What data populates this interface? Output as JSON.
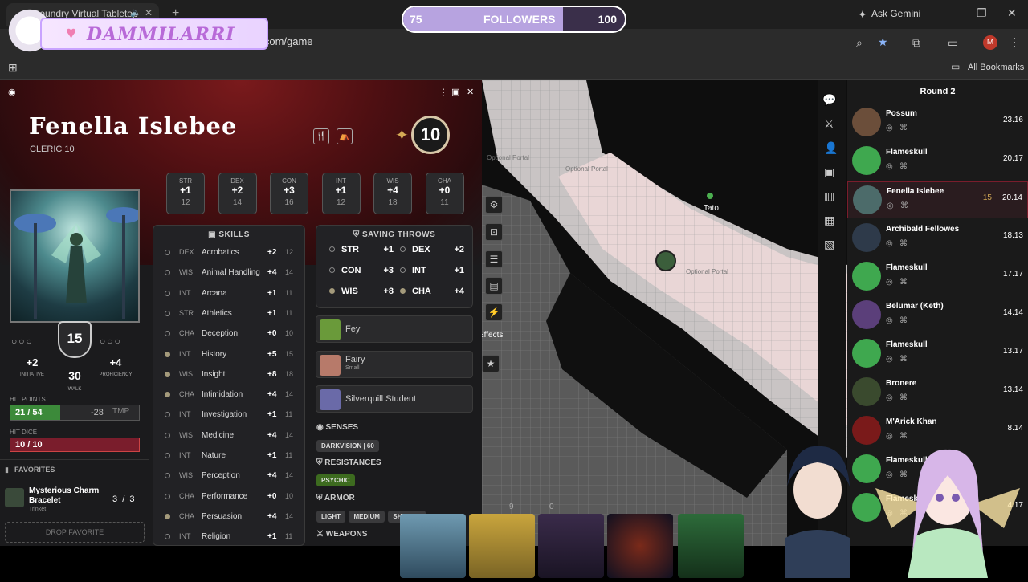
{
  "browser": {
    "tab_title": "Foundry Virtual Tabletop",
    "url": "g.com/game",
    "ask_gemini": "Ask Gemini",
    "profile_initial": "M",
    "all_bookmarks": "All Bookmarks"
  },
  "overlay": {
    "streamer_name": "DAMMILARRI",
    "followers": {
      "start": "75",
      "label": "FOLLOWERS",
      "end": "100",
      "progress": 0.72
    }
  },
  "character": {
    "name": "Fenella Islebee",
    "class_level": "CLERIC 10",
    "level": "10",
    "abilities": [
      {
        "name": "STR",
        "mod": "+1",
        "score": "12"
      },
      {
        "name": "DEX",
        "mod": "+2",
        "score": "14"
      },
      {
        "name": "CON",
        "mod": "+3",
        "score": "16"
      },
      {
        "name": "INT",
        "mod": "+1",
        "score": "12"
      },
      {
        "name": "WIS",
        "mod": "+4",
        "score": "18"
      },
      {
        "name": "CHA",
        "mod": "+0",
        "score": "11"
      }
    ],
    "ac": "15",
    "initiative": "+2",
    "initiative_label": "INITIATIVE",
    "proficiency": "+4",
    "proficiency_label": "PROFICIENCY",
    "walk": "30",
    "walk_label": "WALK",
    "hp_label": "HIT POINTS",
    "hp": "21",
    "hp_max": "54",
    "hp_fraction": 0.39,
    "hp_loss": "-28",
    "tmp_label": "TMP",
    "hd_label": "HIT DICE",
    "hit_dice": "10 / 10",
    "favorites_label": "FAVORITES",
    "favorite": {
      "name": "Mysterious Charm Bracelet",
      "type": "Trinket",
      "uses": "3",
      "max": "3"
    },
    "drop_favorite": "DROP FAVORITE"
  },
  "skills": {
    "title": "SKILLS",
    "rows": [
      {
        "ab": "DEX",
        "name": "Acrobatics",
        "mod": "+2",
        "pass": "12",
        "prof": false
      },
      {
        "ab": "WIS",
        "name": "Animal Handling",
        "mod": "+4",
        "pass": "14",
        "prof": false
      },
      {
        "ab": "INT",
        "name": "Arcana",
        "mod": "+1",
        "pass": "11",
        "prof": false
      },
      {
        "ab": "STR",
        "name": "Athletics",
        "mod": "+1",
        "pass": "11",
        "prof": false
      },
      {
        "ab": "CHA",
        "name": "Deception",
        "mod": "+0",
        "pass": "10",
        "prof": false
      },
      {
        "ab": "INT",
        "name": "History",
        "mod": "+5",
        "pass": "15",
        "prof": true
      },
      {
        "ab": "WIS",
        "name": "Insight",
        "mod": "+8",
        "pass": "18",
        "prof": true
      },
      {
        "ab": "CHA",
        "name": "Intimidation",
        "mod": "+4",
        "pass": "14",
        "prof": true
      },
      {
        "ab": "INT",
        "name": "Investigation",
        "mod": "+1",
        "pass": "11",
        "prof": false
      },
      {
        "ab": "WIS",
        "name": "Medicine",
        "mod": "+4",
        "pass": "14",
        "prof": false
      },
      {
        "ab": "INT",
        "name": "Nature",
        "mod": "+1",
        "pass": "11",
        "prof": false
      },
      {
        "ab": "WIS",
        "name": "Perception",
        "mod": "+4",
        "pass": "14",
        "prof": false
      },
      {
        "ab": "CHA",
        "name": "Performance",
        "mod": "+0",
        "pass": "10",
        "prof": false
      },
      {
        "ab": "CHA",
        "name": "Persuasion",
        "mod": "+4",
        "pass": "14",
        "prof": true
      },
      {
        "ab": "INT",
        "name": "Religion",
        "mod": "+1",
        "pass": "11",
        "prof": false
      }
    ]
  },
  "saves": {
    "title": "SAVING THROWS",
    "rows": [
      {
        "name": "STR",
        "mod": "+1",
        "prof": false
      },
      {
        "name": "DEX",
        "mod": "+2",
        "prof": false
      },
      {
        "name": "CON",
        "mod": "+3",
        "prof": false
      },
      {
        "name": "INT",
        "mod": "+1",
        "prof": false
      },
      {
        "name": "WIS",
        "mod": "+8",
        "prof": true
      },
      {
        "name": "CHA",
        "mod": "+4",
        "prof": true
      }
    ]
  },
  "features": [
    {
      "name": "Fey",
      "sub": ""
    },
    {
      "name": "Fairy",
      "sub": "Small"
    },
    {
      "name": "Silverquill Student",
      "sub": ""
    }
  ],
  "traits": {
    "senses_label": "SENSES",
    "darkvision": "DARKVISION",
    "darkvision_value": "60",
    "resistances_label": "RESISTANCES",
    "resistance": "PSYCHIC",
    "armor_label": "ARMOR",
    "armor": [
      "LIGHT",
      "MEDIUM",
      "SHIELDS"
    ],
    "weapons_label": "WEAPONS"
  },
  "map": {
    "token_name": "Tato",
    "labels": [
      "Optional Portal",
      "Optional Portal",
      "Optional Portal"
    ],
    "tooltip": "Effects",
    "counts": [
      "9",
      "0"
    ]
  },
  "combat": {
    "round": "Round 2",
    "combatants": [
      {
        "name": "Possum",
        "init": "23.16",
        "extra": "",
        "color": "#6b4e3a"
      },
      {
        "name": "Flameskull",
        "init": "20.17",
        "extra": "",
        "color": "#3fa84f"
      },
      {
        "name": "Fenella Islebee",
        "init": "20.14",
        "extra": "15",
        "color": "#4c6b6a"
      },
      {
        "name": "Archibald Fellowes",
        "init": "18.13",
        "extra": "",
        "color": "#2e3a4a"
      },
      {
        "name": "Flameskull",
        "init": "17.17",
        "extra": "",
        "color": "#3fa84f"
      },
      {
        "name": "Belumar (Keth)",
        "init": "14.14",
        "extra": "",
        "color": "#5b3f7a"
      },
      {
        "name": "Flameskull",
        "init": "13.17",
        "extra": "",
        "color": "#3fa84f"
      },
      {
        "name": "Bronere",
        "init": "13.14",
        "extra": "",
        "color": "#3a4a2e"
      },
      {
        "name": "M'Arick Khan",
        "init": "8.14",
        "extra": "",
        "color": "#7a1a1a"
      },
      {
        "name": "Flameskull",
        "init": "",
        "extra": "",
        "color": "#3fa84f"
      },
      {
        "name": "Flameskull",
        "init": "4.17",
        "extra": "",
        "color": "#3fa84f"
      }
    ]
  },
  "colors": {
    "accent": "#7a1d2c",
    "hp": "#3c8a3a",
    "gold": "#d4aa55"
  }
}
